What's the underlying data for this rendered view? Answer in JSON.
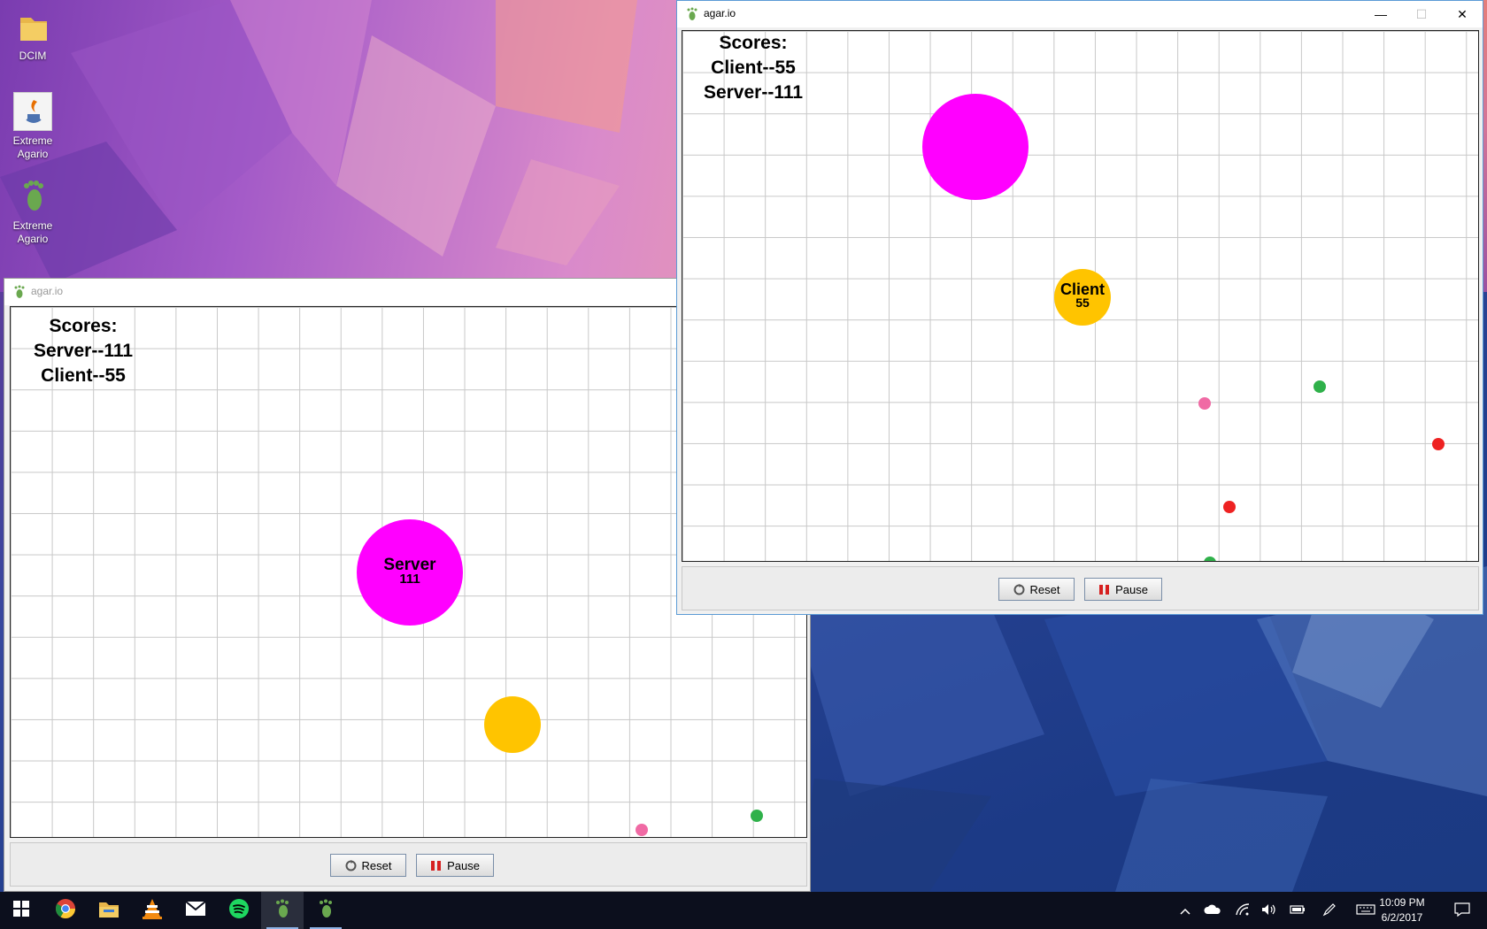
{
  "desktop": {
    "icons": [
      {
        "label": "DCIM",
        "icon": "folder-icon"
      },
      {
        "label": "Extreme\nAgario",
        "icon": "java-icon"
      },
      {
        "label": "Extreme\nAgario",
        "icon": "footprint-icon"
      }
    ]
  },
  "server_window": {
    "title": "agar.io",
    "scores": {
      "heading": "Scores:",
      "line1": "Server--111",
      "line2": "Client--55"
    },
    "cells": {
      "server": {
        "name": "Server",
        "score": "111",
        "color": "#ff00ff"
      },
      "client": {
        "color": "#ffc400"
      }
    },
    "buttons": {
      "reset": "Reset",
      "pause": "Pause"
    }
  },
  "client_window": {
    "title": "agar.io",
    "scores": {
      "heading": "Scores:",
      "line1": "Client--55",
      "line2": "Server--111"
    },
    "cells": {
      "server": {
        "color": "#ff00ff"
      },
      "client": {
        "name": "Client",
        "score": "55",
        "color": "#ffc400"
      }
    },
    "buttons": {
      "reset": "Reset",
      "pause": "Pause"
    },
    "window_controls": {
      "minimize": "—",
      "maximize": "☐",
      "close": "✕"
    }
  },
  "pellet_colors": {
    "pink": "#f06aa4",
    "green": "#2fb14a",
    "red": "#ee2222"
  },
  "taskbar": {
    "apps": [
      "windows-start-icon",
      "chrome-icon",
      "file-explorer-icon",
      "vlc-icon",
      "mail-icon",
      "spotify-icon",
      "agario-server-icon",
      "agario-client-icon"
    ],
    "tray": [
      "chevron-up-icon",
      "onedrive-icon",
      "wifi-icon",
      "volume-icon",
      "battery-icon",
      "pen-icon",
      "keyboard-icon"
    ],
    "time": "10:09 PM",
    "date": "6/2/2017"
  }
}
